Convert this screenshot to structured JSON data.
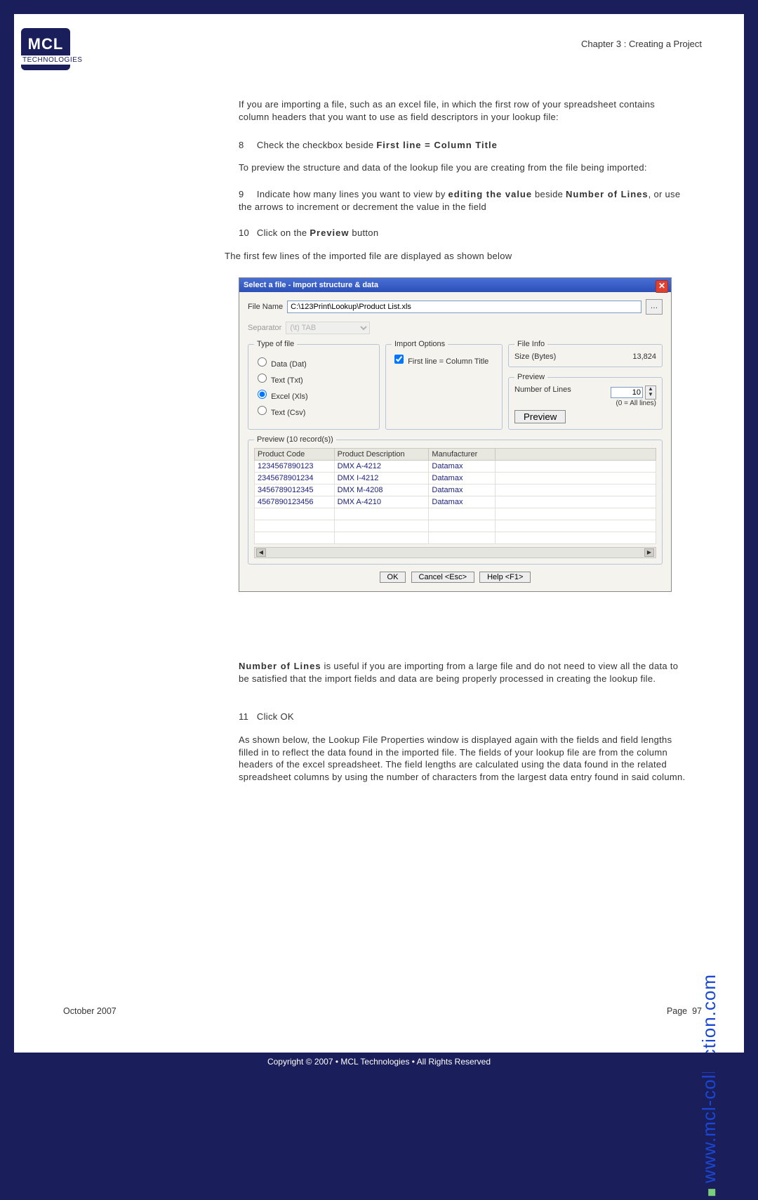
{
  "chapter_title": "Chapter 3 : Creating a Project",
  "logo": {
    "main": "MCL",
    "sub": "TECHNOLOGIES"
  },
  "para1": "If you are importing a file, such as an excel file, in which the first row of your spreadsheet contains column headers that you want to use as field descriptors in your lookup file:",
  "step8_num": "8",
  "step8_text_a": "Check the checkbox beside ",
  "step8_text_b": "First line = Column Title",
  "para2": "To preview the structure and data of the lookup file you are creating from the file being imported:",
  "step9_num": "9",
  "step9_text_a": "Indicate how many lines you want to view by ",
  "step9_text_b": "editing the value",
  "step9_text_c": " beside ",
  "step9_text_d": "Number of Lines",
  "step9_text_e": ", or use the arrows to increment or decrement the value in the field",
  "step10_num": "10",
  "step10_text_a": "Click on the ",
  "step10_text_b": "Preview",
  "step10_text_c": " button",
  "para3": "The first few lines of the imported file are displayed as shown below",
  "dialog": {
    "title": "Select a file - Import structure & data",
    "file_name_label": "File Name",
    "file_name_value": "C:\\123Print\\Lookup\\Product List.xls",
    "separator_label": "Separator",
    "separator_value": "(\\t) TAB",
    "type_legend": "Type of file",
    "type_options": [
      "Data (Dat)",
      "Text (Txt)",
      "Excel (Xls)",
      "Text (Csv)"
    ],
    "type_selected": "Excel (Xls)",
    "import_legend": "Import Options",
    "import_checkbox": "First line = Column Title",
    "fileinfo_legend": "File Info",
    "size_label": "Size (Bytes)",
    "size_value": "13,824",
    "preview_legend": "Preview",
    "numlines_label": "Number of Lines",
    "numlines_value": "10",
    "numlines_note": "(0 = All lines)",
    "preview_btn": "Preview",
    "records_legend": "Preview (10 record(s))",
    "columns": [
      "Product Code",
      "Product Description",
      "Manufacturer"
    ],
    "rows": [
      [
        "1234567890123",
        "DMX A-4212",
        "Datamax"
      ],
      [
        "2345678901234",
        "DMX I-4212",
        "Datamax"
      ],
      [
        "3456789012345",
        "DMX M-4208",
        "Datamax"
      ],
      [
        "4567890123456",
        "DMX A-4210",
        "Datamax"
      ]
    ],
    "ok": "OK",
    "cancel": "Cancel <Esc>",
    "help": "Help <F1>"
  },
  "para4_a": "Number of Lines",
  "para4_b": " is useful if you are importing from a large file and do not need to view all the data to be satisfied that the import fields and data are being properly processed in creating the lookup file.",
  "step11_num": "11",
  "step11_text": "Click OK",
  "para5": "As shown below, the Lookup File Properties window is displayed again with the fields and field lengths filled in to reflect the data found in the imported file. The fields of your lookup file are from the column headers of the excel spreadsheet. The field lengths are calculated using the data found in the related spreadsheet columns by using the number of characters from the largest data entry found in said column.",
  "side_url": "www.mcl-collection.com",
  "footer_date": "October 2007",
  "footer_page_label": "Page",
  "footer_page_num": "97",
  "copyright": "Copyright © 2007 • MCL Technologies • All Rights Reserved"
}
